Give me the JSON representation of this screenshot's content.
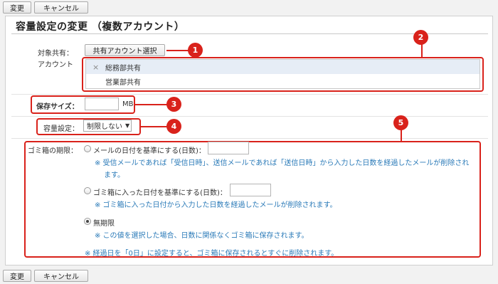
{
  "toolbar": {
    "change": "変更",
    "cancel": "キャンセル"
  },
  "title": "容量設定の変更 （複数アカウント）",
  "target": {
    "label_line1": "対象共有：",
    "label_line2": "アカウント",
    "select_button": "共有アカウント選択",
    "accounts": [
      {
        "remove_icon": "×",
        "name": "総務部共有"
      },
      {
        "name": "営業部共有"
      }
    ]
  },
  "storage": {
    "label": "保存サイズ：",
    "value": "",
    "unit": "MB"
  },
  "capacity": {
    "label": "容量設定：",
    "selected": "制限しない",
    "arrow": "▼"
  },
  "trash": {
    "label": "ゴミ箱の期限：",
    "options": [
      {
        "label": "メールの日付を基準にする(日数)：",
        "value": "",
        "note_line1": "※ 受信メールであれば「受信日時」、送信メールであれば「送信日時」から入力した日数を経過したメールが削除され",
        "note_line2": "ます。",
        "checked": false
      },
      {
        "label": "ゴミ箱に入った日付を基準にする(日数)：",
        "value": "",
        "note_line1": "※ ゴミ箱に入った日付から入力した日数を経過したメールが削除されます。",
        "checked": false
      },
      {
        "label": "無期限",
        "note_line1": "※ この値を選択した場合、日数に関係なくゴミ箱に保存されます。",
        "checked": true
      }
    ],
    "footer_note": "※ 経過日を「0日」に設定すると、ゴミ箱に保存されるとすぐに削除されます。"
  },
  "callouts": [
    "1",
    "2",
    "3",
    "4",
    "5"
  ],
  "colors": {
    "accent": "#d9221b",
    "note": "#2a7ab8"
  }
}
